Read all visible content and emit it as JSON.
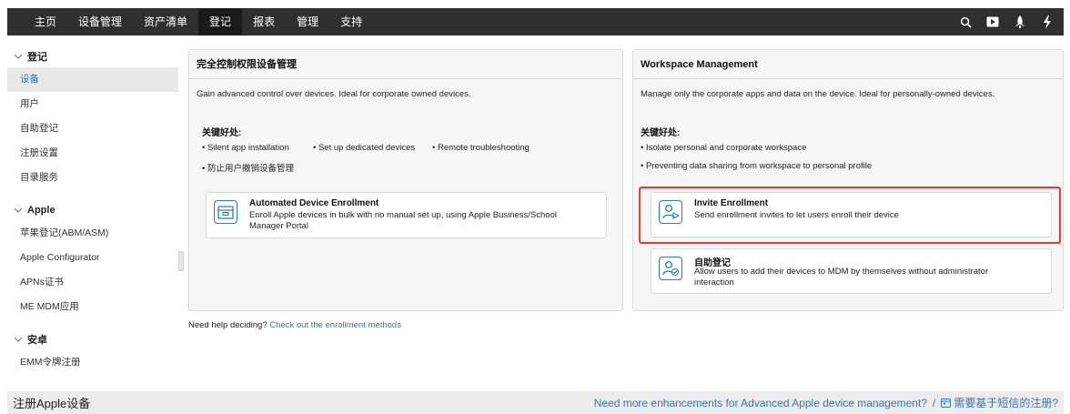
{
  "topnav": {
    "items": [
      {
        "label": "主页"
      },
      {
        "label": "设备管理"
      },
      {
        "label": "资产清单"
      },
      {
        "label": "登记"
      },
      {
        "label": "报表"
      },
      {
        "label": "管理"
      },
      {
        "label": "支持"
      }
    ],
    "active": "登记",
    "icons": [
      "search-icon",
      "video-icon",
      "rocket-icon",
      "lightning-icon"
    ]
  },
  "sidebar": {
    "groups": [
      {
        "label": "登记",
        "items": [
          "设备",
          "用户",
          "自助登记",
          "注册设置",
          "目录服务"
        ]
      },
      {
        "label": "Apple",
        "items": [
          "苹果登记(ABM/ASM)",
          "Apple Configurator",
          "APNs证书",
          "ME MDM应用"
        ]
      },
      {
        "label": "安卓",
        "items": [
          "EMM令牌注册"
        ]
      }
    ],
    "active_item": "设备"
  },
  "full_control": {
    "title": "完全控制权限设备管理",
    "description": "Gain advanced control over devices. Ideal for corporate owned devices.",
    "benefits_title": "关键好处:",
    "benefits": [
      "• Silent app installation",
      "• Set up dedicated devices",
      "• Remote troubleshooting",
      "• 防止用户撤销设备管理"
    ],
    "option": {
      "title": "Automated Device Enrollment",
      "desc_line1": "Enroll Apple devices in bulk with no manual set up, using Apple Business/School",
      "desc_line2": "Manager Portal"
    }
  },
  "workspace": {
    "title": "Workspace Management",
    "description": "Manage only the corporate apps and data on the device. Ideal for personally-owned devices.",
    "benefits_title": "关键好处:",
    "benefits": [
      "• Isolate personal and corporate workspace",
      "• Preventing data sharing from workspace to personal profile"
    ],
    "option1": {
      "title": "Invite Enrollment",
      "desc_line1": "Send enrollment invites to let users enroll their device"
    },
    "option2": {
      "title": "自助登记",
      "desc_line1": "Allow users to add their devices to MDM by themselves without administrator",
      "desc_line2": "interaction"
    }
  },
  "help": {
    "text": "Need help deciding?",
    "link": "Check out the enrollment methods"
  },
  "footer": {
    "title": "注册Apple设备",
    "link1": "Need more enhancements for Advanced Apple device management?",
    "separator": "/",
    "link2": "需要基于短信的注册?"
  },
  "colors": {
    "nav_bg": "#2f2f2f",
    "accent": "#2a7bb8",
    "highlight": "#e53935"
  }
}
